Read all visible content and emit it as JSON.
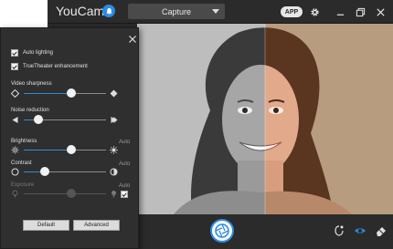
{
  "app": {
    "title": "YouCam",
    "mode": "Capture",
    "app_badge": "APP",
    "accent": "#2e8be0"
  },
  "settings": {
    "auto_lighting": {
      "label": "Auto lighting",
      "checked": true
    },
    "truetheater": {
      "label": "TrueTheater enhancement",
      "checked": true
    },
    "sliders": [
      {
        "key": "video_sharpness",
        "label": "Video sharpness",
        "value": 0.58,
        "auto": false,
        "enabled": true
      },
      {
        "key": "noise_reduction",
        "label": "Noise reduction",
        "value": 0.18,
        "auto": false,
        "enabled": true
      },
      {
        "key": "brightness",
        "label": "Brightness",
        "value": 0.58,
        "auto": true,
        "enabled": true
      },
      {
        "key": "contrast",
        "label": "Contrast",
        "value": 0.26,
        "auto": true,
        "enabled": true
      },
      {
        "key": "exposure",
        "label": "Exposure",
        "value": 0.58,
        "auto": true,
        "enabled": false
      }
    ],
    "auto_label": "Auto",
    "exposure_auto_checked": true,
    "default_button": "Default",
    "advanced_button": "Advanced"
  },
  "icons": {
    "notification": "bell-icon",
    "settings": "gear-icon",
    "minimize": "minimize-icon",
    "maximize": "maximize-icon",
    "close": "close-icon",
    "shutter": "camera-shutter-icon",
    "face": "face-icon",
    "eye": "eye-icon",
    "eraser": "eraser-icon"
  }
}
